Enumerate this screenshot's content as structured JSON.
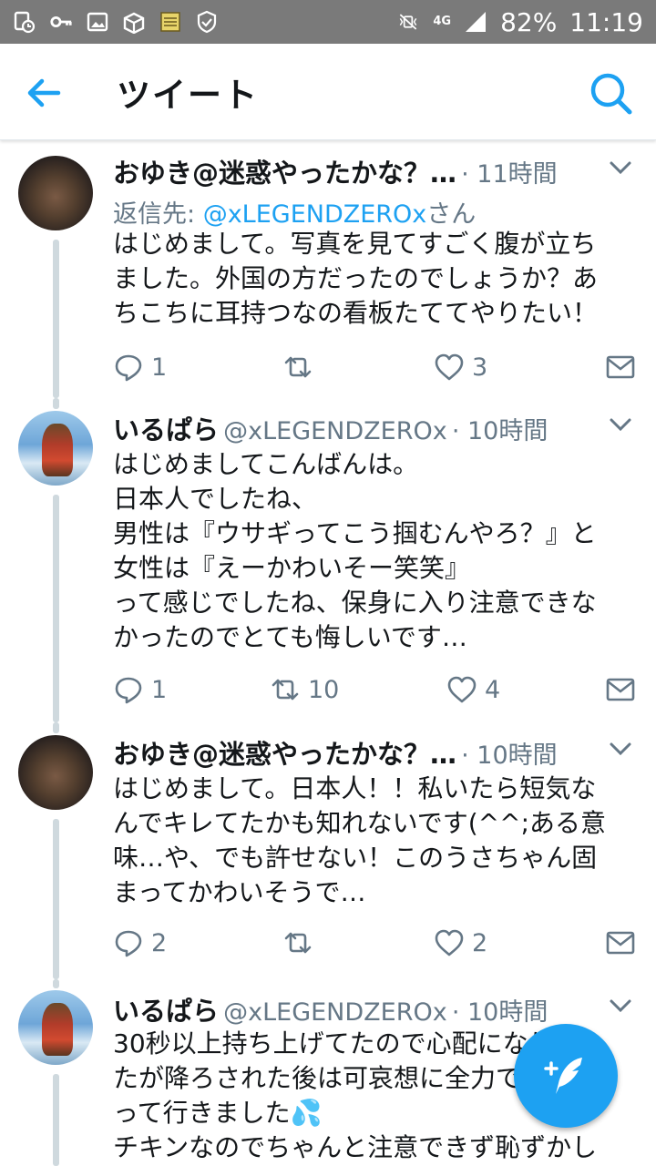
{
  "statusbar": {
    "network": "4G",
    "battery": "82%",
    "time": "11:19"
  },
  "appbar": {
    "title": "ツイート"
  },
  "tweets": [
    {
      "name": "おゆき@迷惑やったかな？…",
      "handle": "",
      "time": "11時間",
      "reply_prefix": "返信先: ",
      "reply_mention": "@xLEGENDZEROx",
      "reply_suffix": "さん",
      "body": "はじめまして。写真を見てすごく腹が立ち\nました。外国の方だったのでしょうか？あ\nちこちに耳持つなの看板たててやりたい！",
      "replies": "1",
      "retweets": "",
      "likes": "3"
    },
    {
      "name": "いるぱら",
      "handle": "@xLEGENDZEROx",
      "time": "10時間",
      "body": "はじめましてこんばんは。\n日本人でしたね、\n男性は『ウサギってこう掴むんやろ？』と\n女性は『えーかわいそー笑笑』\nって感じでしたね、保身に入り注意できな\nかったのでとても悔しいです…",
      "replies": "1",
      "retweets": "10",
      "likes": "4"
    },
    {
      "name": "おゆき@迷惑やったかな？…",
      "handle": "",
      "time": "10時間",
      "body": "はじめまして。日本人！！私いたら短気な\nんでキレてたかも知れないです(^^;ある意\n味…や、でも許せない！このうさちゃん固\nまってかわいそうで…",
      "replies": "2",
      "retweets": "",
      "likes": "2"
    },
    {
      "name": "いるぱら",
      "handle": "@xLEGENDZEROx",
      "time": "10時間",
      "body": "30秒以上持ち上げてたので心配になりまし\nたが降ろされた後は可哀想に全力で走\nって行きました💦\nチキンなのでちゃんと注意できず恥ずかし",
      "replies": "",
      "retweets": "",
      "likes": ""
    }
  ],
  "colors": {
    "accent": "#1da1f2",
    "text": "#14171a",
    "muted": "#657786",
    "statusbar": "#7a7a7a"
  }
}
